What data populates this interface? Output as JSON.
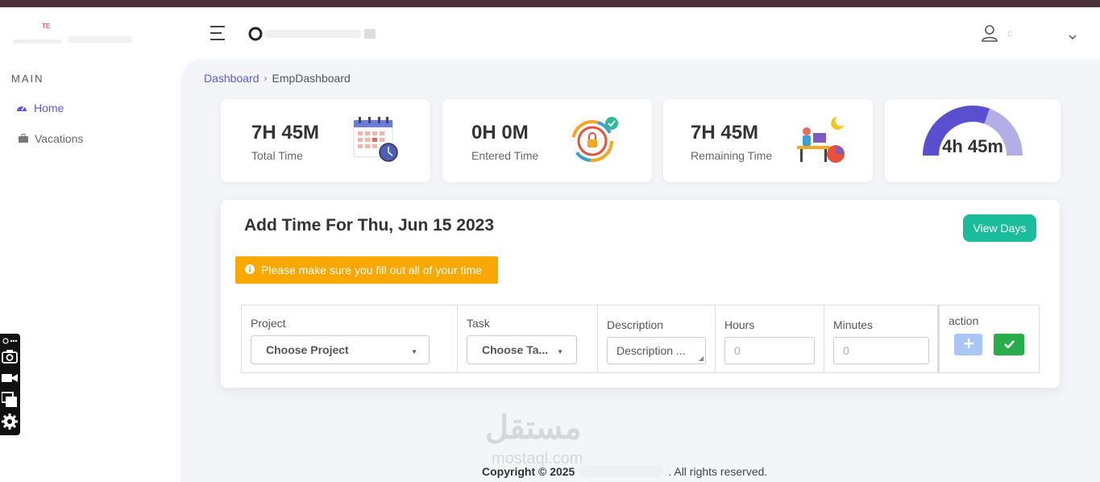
{
  "header": {
    "menu_icon": "hamburger-menu-icon",
    "user_icon": "user-outline-icon",
    "user_name": "c"
  },
  "sidebar": {
    "section_title": "MAIN",
    "items": [
      {
        "label": "Home",
        "icon": "dashboard-gauge-icon",
        "active": true
      },
      {
        "label": "Vacations",
        "icon": "briefcase-icon",
        "active": false
      }
    ]
  },
  "breadcrumb": {
    "link": "Dashboard",
    "separator": "›",
    "current": "EmpDashboard"
  },
  "stats": [
    {
      "value": "7H 45M",
      "label": "Total Time",
      "icon": "calendar-clock-icon"
    },
    {
      "value": "0H 0M",
      "label": "Entered Time",
      "icon": "timer-lock-icon"
    },
    {
      "value": "7H 45M",
      "label": "Remaining Time",
      "icon": "desk-worker-icon"
    }
  ],
  "gauge": {
    "text": "4h 45m",
    "filled_fraction": 0.61,
    "fill_color": "#5a4fcf",
    "track_color": "#b3aee6"
  },
  "form": {
    "title": "Add Time For Thu, Jun 15 2023",
    "view_days_label": "View Days",
    "warning_text": "Please make sure you fill out all of your time",
    "columns": {
      "project": {
        "label": "Project",
        "value": "Choose Project"
      },
      "task": {
        "label": "Task",
        "value": "Choose Ta..."
      },
      "description": {
        "label": "Description",
        "placeholder": "Description ..."
      },
      "hours": {
        "label": "Hours",
        "placeholder": "0"
      },
      "minutes": {
        "label": "Minutes",
        "placeholder": "0"
      },
      "action": {
        "label": "action"
      }
    }
  },
  "watermark": {
    "arabic": "مستقل",
    "latin": "mostaql.com"
  },
  "footer": {
    "copyright": "Copyright © 2025",
    "rights": ". All rights reserved."
  },
  "colors": {
    "accent": "#5a5ae0",
    "teal": "#1abc9c",
    "warning": "#f9a800",
    "success": "#27ae4a",
    "add_button": "#a9c6f5",
    "top_strip": "#4a3038"
  }
}
